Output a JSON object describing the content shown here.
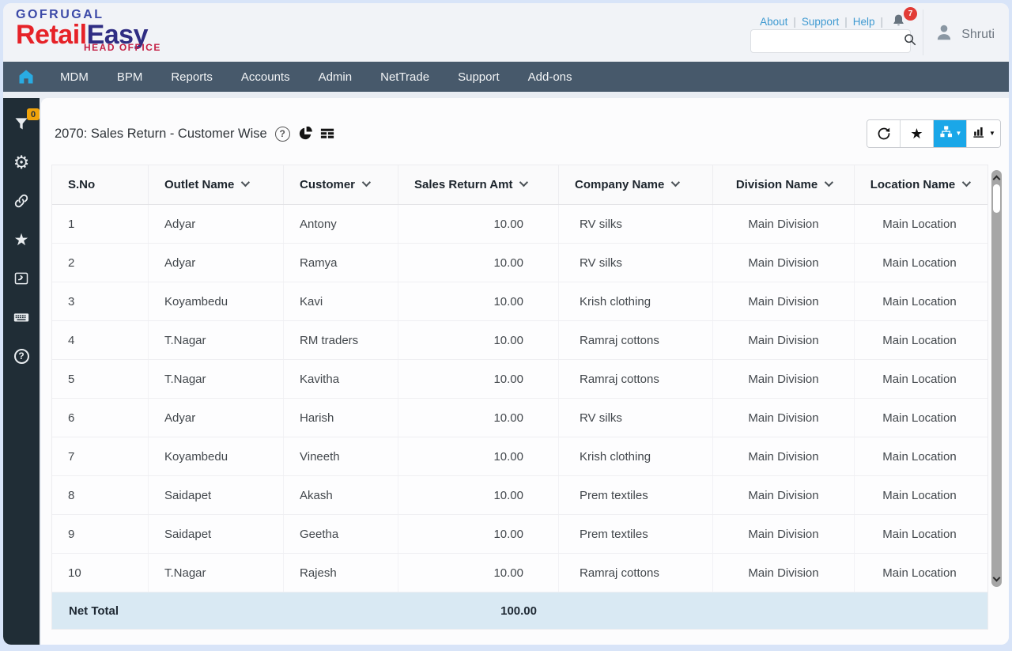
{
  "branding": {
    "company": "GOFRUGAL",
    "product_red": "Retail",
    "product_indigo": "Easy",
    "edition": "HEAD OFFICE"
  },
  "topbar": {
    "links": [
      "About",
      "Support",
      "Help"
    ],
    "notification_count": "7",
    "search_value": "",
    "user_name": "Shruti"
  },
  "nav": {
    "items": [
      "MDM",
      "BPM",
      "Reports",
      "Accounts",
      "Admin",
      "NetTrade",
      "Support",
      "Add-ons"
    ]
  },
  "sidebar": {
    "filter_badge": "0",
    "help_glyph": "?"
  },
  "report": {
    "title": "2070: Sales Return - Customer Wise",
    "help_glyph": "?"
  },
  "table": {
    "headers": [
      {
        "label": "S.No"
      },
      {
        "label": "Outlet Name"
      },
      {
        "label": "Customer"
      },
      {
        "label": "Sales Return Amt"
      },
      {
        "label": "Company Name"
      },
      {
        "label": "Division Name"
      },
      {
        "label": "Location Name"
      }
    ],
    "rows": [
      {
        "sno": "1",
        "outlet": "Adyar",
        "customer": "Antony",
        "amount": "10.00",
        "company": "RV silks",
        "division": "Main Division",
        "location": "Main Location"
      },
      {
        "sno": "2",
        "outlet": "Adyar",
        "customer": "Ramya",
        "amount": "10.00",
        "company": "RV silks",
        "division": "Main Division",
        "location": "Main Location"
      },
      {
        "sno": "3",
        "outlet": "Koyambedu",
        "customer": "Kavi",
        "amount": "10.00",
        "company": "Krish clothing",
        "division": "Main Division",
        "location": "Main Location"
      },
      {
        "sno": "4",
        "outlet": "T.Nagar",
        "customer": "RM traders",
        "amount": "10.00",
        "company": "Ramraj cottons",
        "division": "Main Division",
        "location": "Main Location"
      },
      {
        "sno": "5",
        "outlet": "T.Nagar",
        "customer": "Kavitha",
        "amount": "10.00",
        "company": "Ramraj cottons",
        "division": "Main Division",
        "location": "Main Location"
      },
      {
        "sno": "6",
        "outlet": "Adyar",
        "customer": "Harish",
        "amount": "10.00",
        "company": "RV silks",
        "division": "Main Division",
        "location": "Main Location"
      },
      {
        "sno": "7",
        "outlet": "Koyambedu",
        "customer": "Vineeth",
        "amount": "10.00",
        "company": "Krish clothing",
        "division": "Main Division",
        "location": "Main Location"
      },
      {
        "sno": "8",
        "outlet": "Saidapet",
        "customer": "Akash",
        "amount": "10.00",
        "company": "Prem textiles",
        "division": "Main Division",
        "location": "Main Location"
      },
      {
        "sno": "9",
        "outlet": "Saidapet",
        "customer": "Geetha",
        "amount": "10.00",
        "company": "Prem textiles",
        "division": "Main Division",
        "location": "Main Location"
      },
      {
        "sno": "10",
        "outlet": "T.Nagar",
        "customer": "Rajesh",
        "amount": "10.00",
        "company": "Ramraj cottons",
        "division": "Main Division",
        "location": "Main Location"
      }
    ],
    "net_total": {
      "label": "Net Total",
      "amount": "100.00"
    }
  },
  "colors": {
    "accent_blue": "#1aa7e8",
    "nav_bg": "#47596b",
    "sidebar_bg": "#202d36",
    "net_total_bg": "#d9e9f3",
    "notification_badge_red": "#e23c36",
    "filter_badge_orange": "#f0a30a",
    "link_blue": "#3f9ad1",
    "logo_red": "#e62228",
    "logo_indigo": "#2f2d83",
    "logo_blue": "#3c4aa8"
  }
}
